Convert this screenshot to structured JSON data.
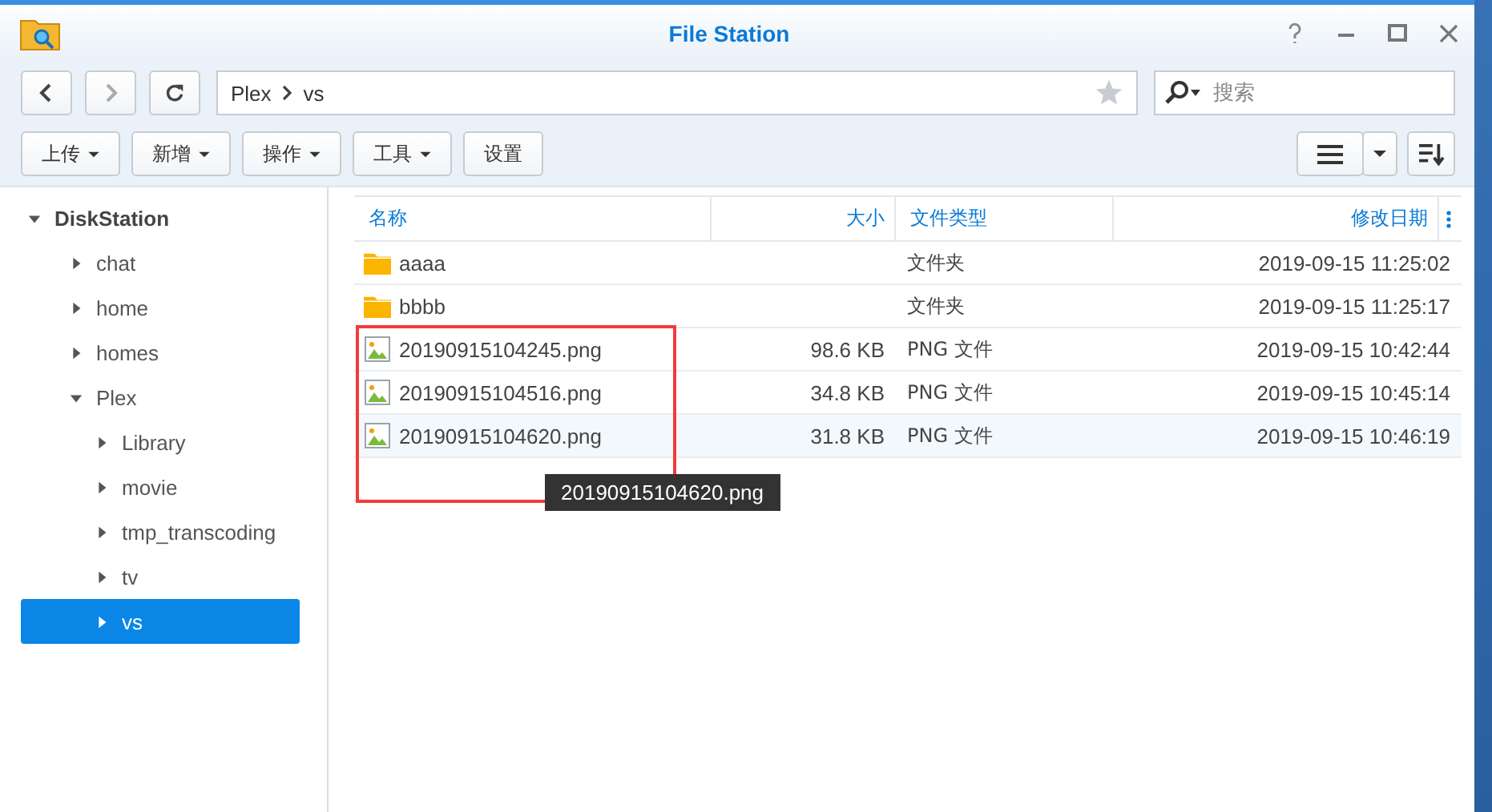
{
  "window": {
    "title": "File Station"
  },
  "nav": {
    "path": [
      "Plex",
      "vs"
    ],
    "search": {
      "placeholder": "搜索"
    }
  },
  "toolbar": {
    "buttons": [
      {
        "label": "上传",
        "dropdown": true
      },
      {
        "label": "新增",
        "dropdown": true
      },
      {
        "label": "操作",
        "dropdown": true
      },
      {
        "label": "工具",
        "dropdown": true
      },
      {
        "label": "设置",
        "dropdown": false
      }
    ]
  },
  "sidebar": {
    "items": [
      {
        "label": "DiskStation",
        "expanded": true,
        "selected": false,
        "children": [
          {
            "label": "chat",
            "expanded": false,
            "selected": false
          },
          {
            "label": "home",
            "expanded": false,
            "selected": false
          },
          {
            "label": "homes",
            "expanded": false,
            "selected": false
          },
          {
            "label": "Plex",
            "expanded": true,
            "selected": false,
            "children": [
              {
                "label": "Library",
                "expanded": false,
                "selected": false
              },
              {
                "label": "movie",
                "expanded": false,
                "selected": false
              },
              {
                "label": "tmp_transcoding",
                "expanded": false,
                "selected": false
              },
              {
                "label": "tv",
                "expanded": false,
                "selected": false
              },
              {
                "label": "vs",
                "expanded": false,
                "selected": true
              }
            ]
          }
        ]
      }
    ]
  },
  "table": {
    "columns": [
      "名称",
      "大小",
      "文件类型",
      "修改日期"
    ],
    "rows": [
      {
        "kind": "folder",
        "name": "aaaa",
        "size": "",
        "type": "文件夹",
        "modified": "2019-09-15 11:25:02",
        "hovered": false,
        "framed": false
      },
      {
        "kind": "folder",
        "name": "bbbb",
        "size": "",
        "type": "文件夹",
        "modified": "2019-09-15 11:25:17",
        "hovered": false,
        "framed": false
      },
      {
        "kind": "image",
        "name": "20190915104245.png",
        "size": "98.6 KB",
        "type": "PNG 文件",
        "modified": "2019-09-15 10:42:44",
        "hovered": false,
        "framed": true
      },
      {
        "kind": "image",
        "name": "20190915104516.png",
        "size": "34.8 KB",
        "type": "PNG 文件",
        "modified": "2019-09-15 10:45:14",
        "hovered": false,
        "framed": true
      },
      {
        "kind": "image",
        "name": "20190915104620.png",
        "size": "31.8 KB",
        "type": "PNG 文件",
        "modified": "2019-09-15 10:46:19",
        "hovered": true,
        "framed": true
      }
    ]
  },
  "tooltip": {
    "text": "20190915104620.png"
  }
}
